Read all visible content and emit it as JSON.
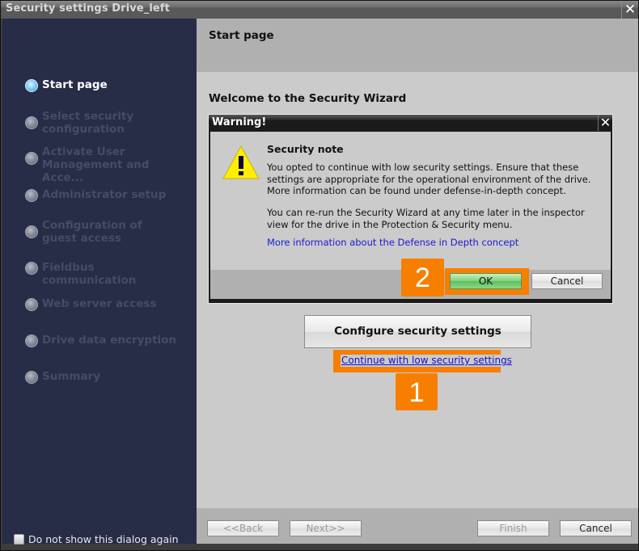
{
  "window": {
    "title": "Security settings Drive_left",
    "close_icon": "close-icon"
  },
  "sidebar": {
    "steps": [
      {
        "label": "Start page",
        "active": true
      },
      {
        "label": "Select security configuration",
        "active": false
      },
      {
        "label": "Activate User Management and Acce...",
        "active": false
      },
      {
        "label": "Administrator setup",
        "active": false
      },
      {
        "label": "Configuration of guest access",
        "active": false
      },
      {
        "label": "Fieldbus communication",
        "active": false
      },
      {
        "label": "Web server access",
        "active": false
      },
      {
        "label": "Drive data encryption",
        "active": false
      },
      {
        "label": "Summary",
        "active": false
      }
    ],
    "dont_show_label": "Do not show this dialog again",
    "dont_show_checked": false
  },
  "main": {
    "header_title": "Start page",
    "welcome": "Welcome to the Security Wizard",
    "configure_button": "Configure security settings",
    "continue_link": "Continue with low security settings",
    "badge1": "1"
  },
  "dialog": {
    "title": "Warning!",
    "icon": "warning-triangle-icon",
    "note_title": "Security note",
    "note_text": "You opted to continue with low security settings. Ensure that these settings are appropriate for the operational environment of the drive. More information can be found under defense-in-depth concept.",
    "note_text2": "You can re-run the Security Wizard at any time later in the inspector view for the drive in the Protection & Security menu.",
    "link": "More information about the Defense in Depth concept",
    "ok_label": "OK",
    "cancel_label": "Cancel",
    "badge2": "2"
  },
  "footer": {
    "back_label": "<<Back",
    "next_label": "Next>>",
    "finish_label": "Finish",
    "cancel_label": "Cancel"
  },
  "colors": {
    "sidebar_bg": "#272c47",
    "highlight_orange": "#f77f00",
    "link_blue": "#1010d0"
  }
}
